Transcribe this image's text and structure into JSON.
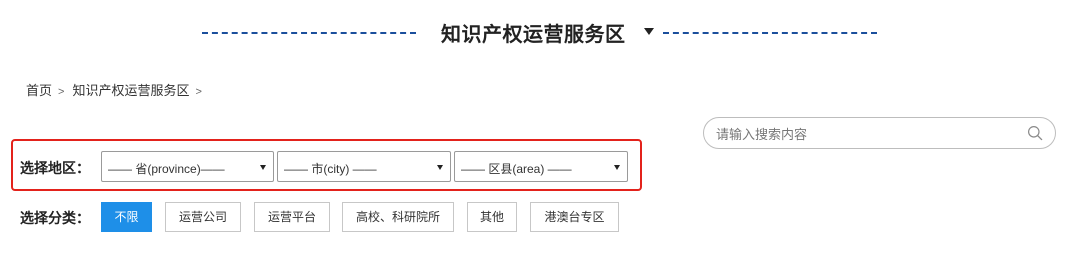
{
  "header": {
    "title": "知识产权运营服务区"
  },
  "breadcrumb": {
    "home": "首页",
    "separator": ">",
    "current": "知识产权运营服务区"
  },
  "search": {
    "placeholder": "请输入搜索内容",
    "icon": "search-icon"
  },
  "region": {
    "label": "选择地区：",
    "selects": [
      {
        "value": "—— 省(province)——"
      },
      {
        "value": "—— 市(city) ——"
      },
      {
        "value": "—— 区县(area) ——"
      }
    ]
  },
  "category": {
    "label": "选择分类：",
    "buttons": [
      {
        "label": "不限",
        "active": true
      },
      {
        "label": "运营公司"
      },
      {
        "label": "运营平台"
      },
      {
        "label": "高校、科研院所"
      },
      {
        "label": "其他"
      },
      {
        "label": "港澳台专区"
      }
    ]
  },
  "colors": {
    "accent": "#1e8fe8",
    "highlight_border": "#e3221b",
    "header_dash": "#1b4f9c"
  }
}
